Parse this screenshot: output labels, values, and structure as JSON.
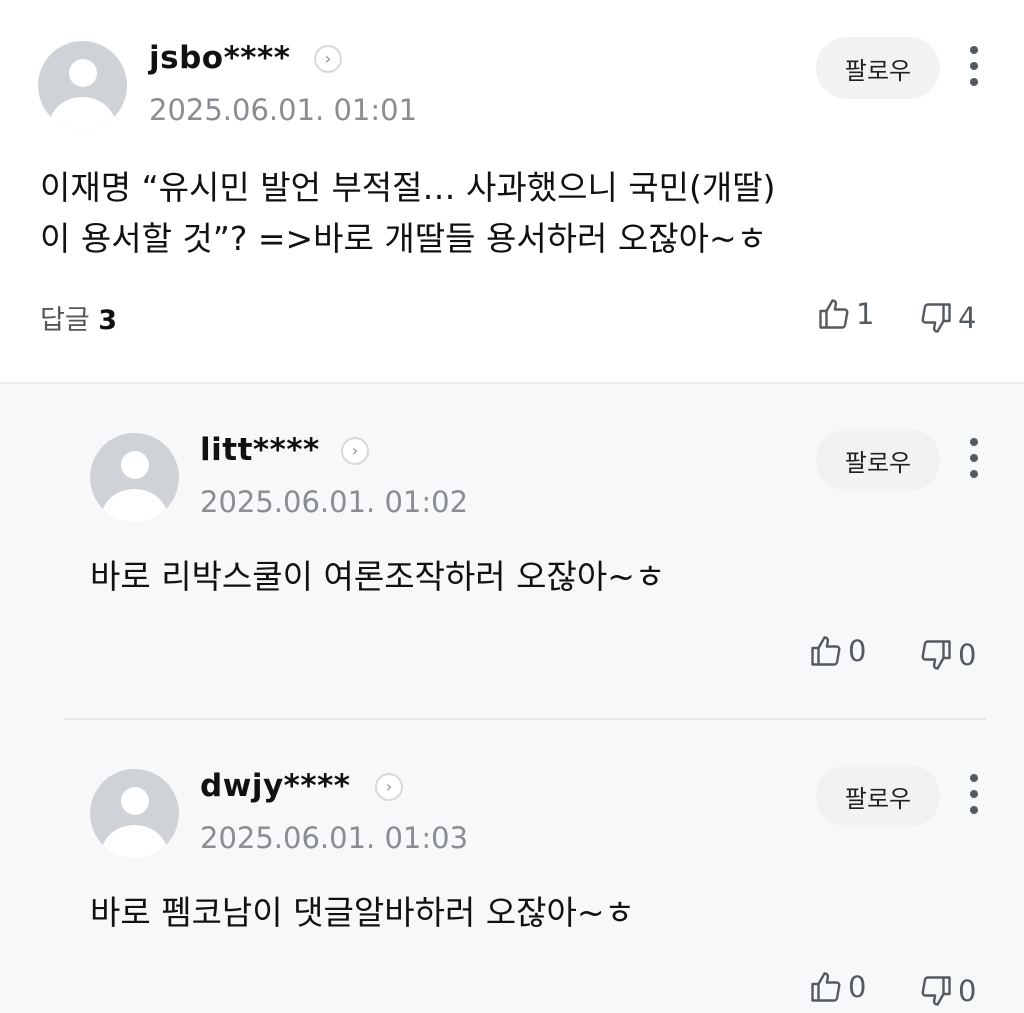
{
  "comment": {
    "username": "jsbo****",
    "date": "2025.06.01. 01:01",
    "follow_label": "팔로우",
    "text_line1": "이재명 “유시민 발언 부적절… 사과했으니 국민(개딸)",
    "text_line2": "이 용서할 것”? =>바로 개딸들 용서하러 오잖아~ㅎ",
    "reply_label": "답글",
    "reply_count": "3",
    "likes": "1",
    "dislikes": "4"
  },
  "replies": [
    {
      "username": "litt****",
      "date": "2025.06.01. 01:02",
      "follow_label": "팔로우",
      "text": "바로 리박스쿨이 여론조작하러 오잖아~ㅎ",
      "likes": "0",
      "dislikes": "0"
    },
    {
      "username": "dwjy****",
      "date": "2025.06.01. 01:03",
      "follow_label": "팔로우",
      "text": "바로 펨코남이 댓글알바하러 오잖아~ㅎ",
      "likes": "0",
      "dislikes": "0"
    }
  ],
  "icons": {
    "profile": "avatar-default-icon",
    "chevron": "chevron-right-icon",
    "more": "more-vertical-icon",
    "like": "thumbs-up-icon",
    "dislike": "thumbs-down-icon"
  }
}
